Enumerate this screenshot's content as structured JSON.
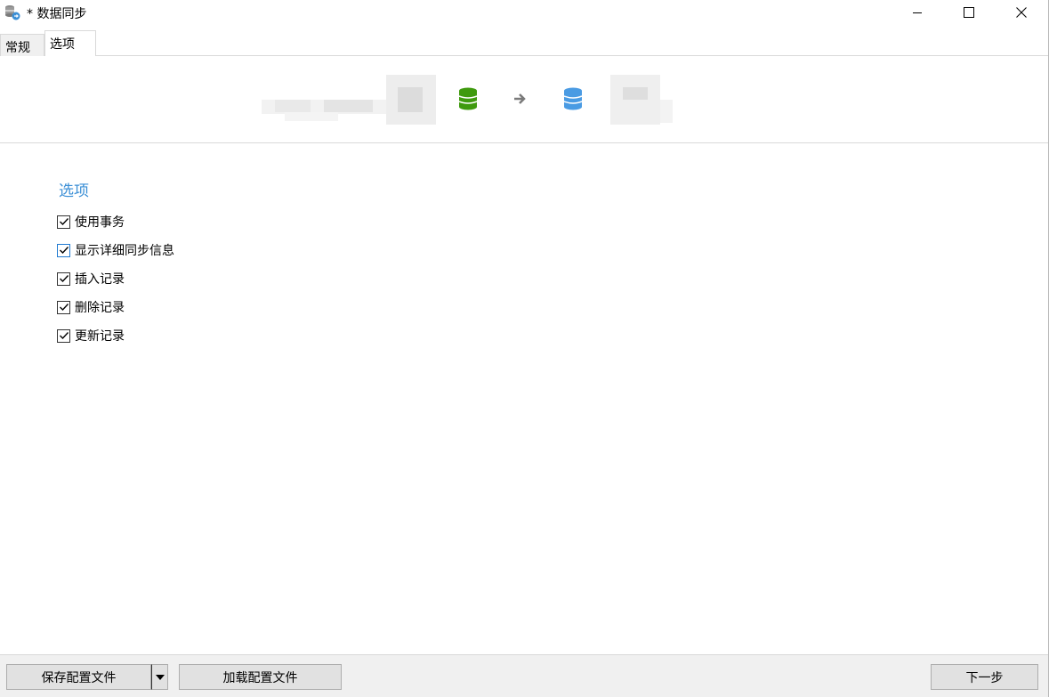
{
  "window": {
    "title": "* 数据同步",
    "controls": {
      "minimize": "minimize-icon",
      "maximize": "maximize-icon",
      "close": "close-icon"
    }
  },
  "tabs": [
    {
      "label": "常规",
      "active": false
    },
    {
      "label": "选项",
      "active": true
    }
  ],
  "diagram": {
    "source_icon": "database-icon",
    "source_color": "#3f9a0e",
    "arrow_icon": "arrow-right-icon",
    "target_icon": "database-icon",
    "target_color": "#4a9be3"
  },
  "options": {
    "section_title": "选项",
    "items": [
      {
        "label": "使用事务",
        "checked": true
      },
      {
        "label": "显示详细同步信息",
        "checked": true
      },
      {
        "label": "插入记录",
        "checked": true
      },
      {
        "label": "删除记录",
        "checked": true
      },
      {
        "label": "更新记录",
        "checked": true
      }
    ]
  },
  "footer": {
    "save_label": "保存配置文件",
    "load_label": "加载配置文件",
    "next_label": "下一步"
  },
  "colors": {
    "accent": "#3b8fd6",
    "button_bg": "#e1e1e1"
  }
}
